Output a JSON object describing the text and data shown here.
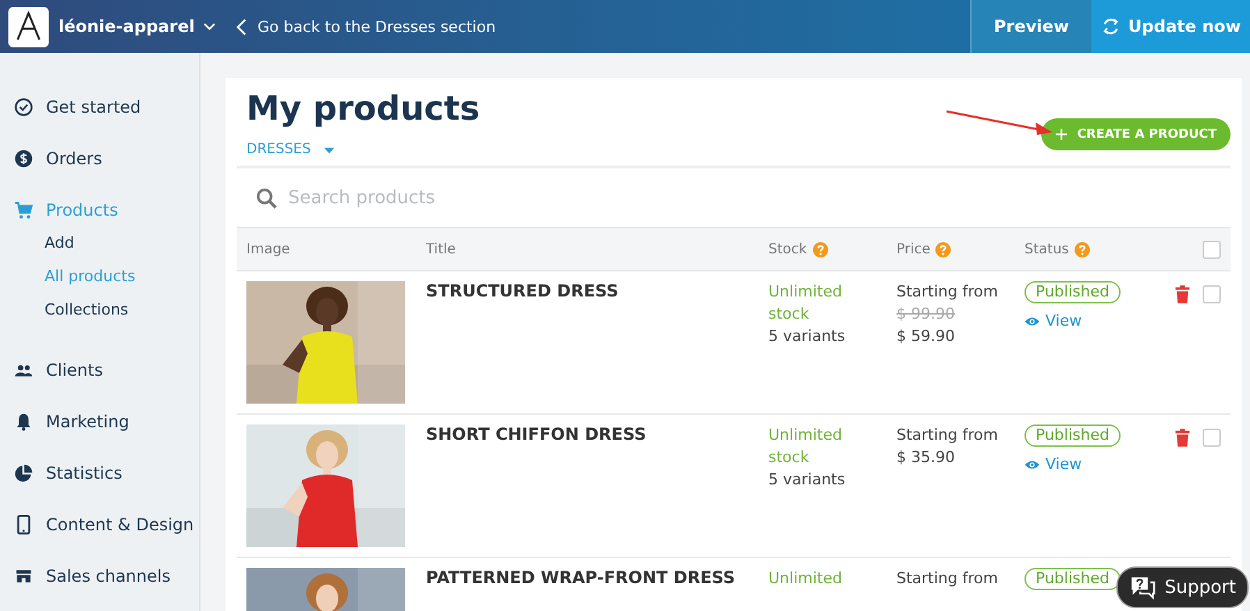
{
  "topbar": {
    "store_name": "léonie-apparel",
    "back_link": "Go back to the Dresses section",
    "preview": "Preview",
    "update": "Update now"
  },
  "sidebar": {
    "items": [
      {
        "label": "Get started",
        "selected": false
      },
      {
        "label": "Orders",
        "selected": false
      },
      {
        "label": "Products",
        "selected": true,
        "expanded": true,
        "children": [
          {
            "label": "Add",
            "selected": false
          },
          {
            "label": "All products",
            "selected": true
          },
          {
            "label": "Collections",
            "selected": false
          }
        ]
      },
      {
        "label": "Clients",
        "selected": false
      },
      {
        "label": "Marketing",
        "selected": false
      },
      {
        "label": "Statistics",
        "selected": false
      },
      {
        "label": "Content & Design",
        "selected": false
      },
      {
        "label": "Sales channels",
        "selected": false
      }
    ]
  },
  "page": {
    "title": "My products",
    "filter": "DRESSES",
    "create_button": "CREATE A PRODUCT",
    "search": {
      "placeholder": "Search products"
    }
  },
  "table": {
    "columns": [
      {
        "label": "Image",
        "help": false
      },
      {
        "label": "Title",
        "help": false
      },
      {
        "label": "Stock",
        "help": true
      },
      {
        "label": "Price",
        "help": true
      },
      {
        "label": "Status",
        "help": true
      }
    ],
    "all_checked": false,
    "rows": [
      {
        "title": "STRUCTURED DRESS",
        "stock": "Unlimited stock",
        "variants": "5 variants",
        "price_label": "Starting from",
        "old_price": "$ 99.90",
        "price": "$ 59.90",
        "status": "Published",
        "view": "View",
        "checked": false
      },
      {
        "title": "SHORT CHIFFON DRESS",
        "stock": "Unlimited stock",
        "variants": "5 variants",
        "price_label": "Starting from",
        "price": "$ 35.90",
        "status": "Published",
        "view": "View",
        "checked": false
      },
      {
        "title": "PATTERNED WRAP-FRONT DRESS",
        "stock": "Unlimited",
        "price_label": "Starting from",
        "status": "Published"
      }
    ]
  },
  "support": "Support"
}
